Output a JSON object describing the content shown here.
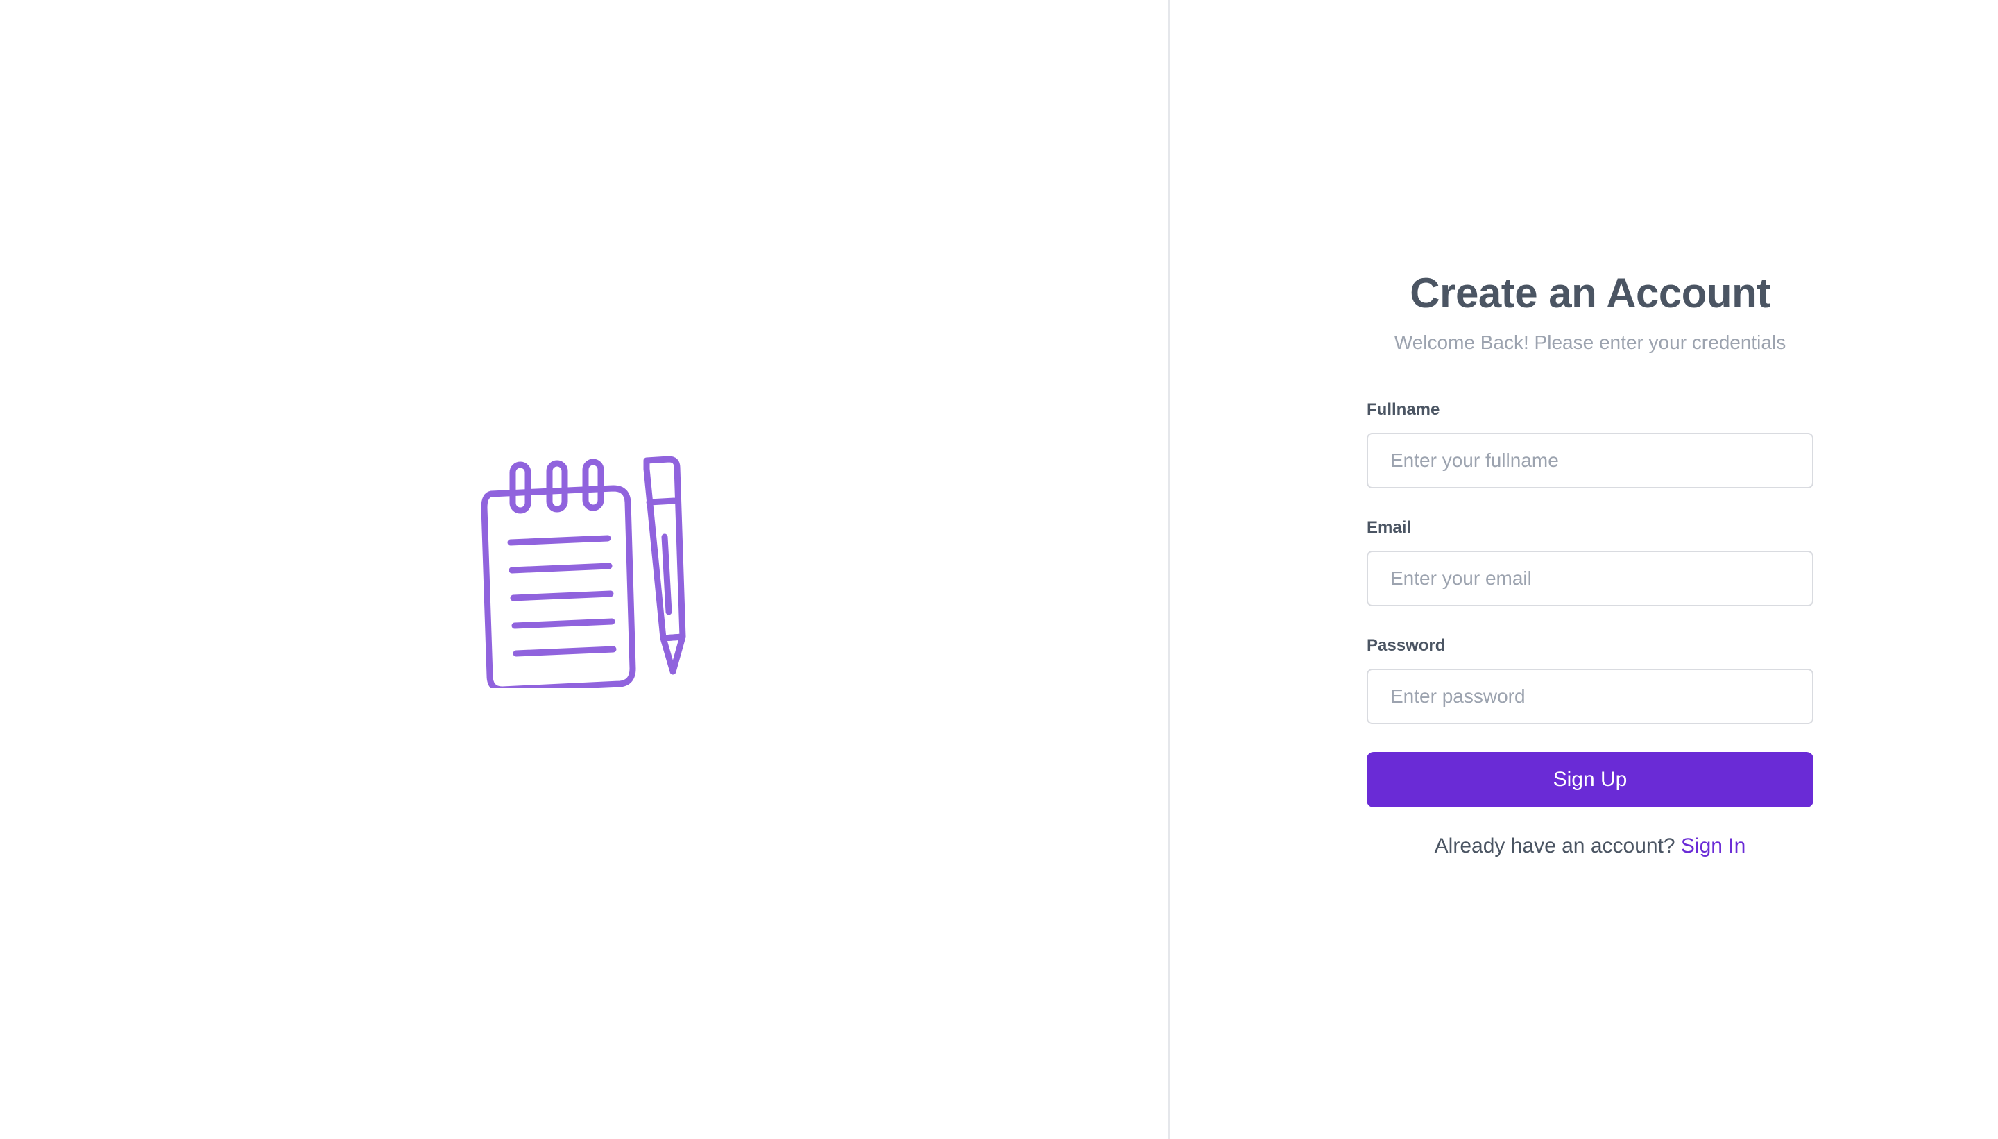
{
  "hero": {
    "icon": "notepad-pencil-icon",
    "accent_color": "#9063dd"
  },
  "form": {
    "title": "Create an Account",
    "subtitle": "Welcome Back! Please enter your credentials",
    "fullname": {
      "label": "Fullname",
      "placeholder": "Enter your fullname",
      "value": ""
    },
    "email": {
      "label": "Email",
      "placeholder": "Enter your email",
      "value": ""
    },
    "password": {
      "label": "Password",
      "placeholder": "Enter password",
      "value": ""
    },
    "submit_label": "Sign Up",
    "footer_text": "Already have an account?",
    "signin_label": "Sign In",
    "primary_color": "#6a2bd6"
  }
}
